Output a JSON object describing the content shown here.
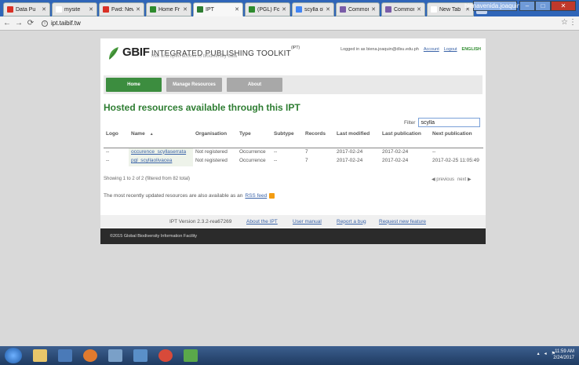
{
  "browser": {
    "tabs": [
      {
        "title": "Data Pu",
        "color": "#d93025"
      },
      {
        "title": "mysite",
        "color": "#ffffff"
      },
      {
        "title": "Fwd: New",
        "color": "#d93025"
      },
      {
        "title": "Home Fr",
        "color": "#2e8b2e"
      },
      {
        "title": "IPT",
        "color": "#2e7d32"
      },
      {
        "title": "(PGL) For",
        "color": "#2e8b2e"
      },
      {
        "title": "scylla olv",
        "color": "#4285f4"
      },
      {
        "title": "Commor",
        "color": "#7a5ca8"
      },
      {
        "title": "Commor",
        "color": "#7a5ca8"
      },
      {
        "title": "New Tab",
        "color": "#ffffff"
      }
    ],
    "profile_label": "bienavenida.joaquin...",
    "url": "ipt.taibif.tw"
  },
  "header": {
    "brand": "GBIF",
    "title": "INTEGRATED PUBLISHING TOOLKIT",
    "title_sup": "(IPT)",
    "tagline": "free and open access to biodiversity data",
    "logged_in": "Logged in as biena.joaquin@dlsu.edu.ph",
    "account": "Account",
    "logout": "Logout",
    "language": "ENGLISH"
  },
  "nav": {
    "home": "Home",
    "manage": "Manage Resources",
    "about": "About"
  },
  "heading": "Hosted resources available through this IPT",
  "filter": {
    "label": "Filter",
    "value": "scylla"
  },
  "table": {
    "headers": [
      "Logo",
      "Name",
      "Organisation",
      "Type",
      "Subtype",
      "Records",
      "Last modified",
      "Last publication",
      "Next publication"
    ],
    "rows": [
      [
        "--",
        "occurence_scyllaserrata",
        "Not registered",
        "Occurrence",
        "--",
        "7",
        "2017-02-24",
        "2017-02-24",
        "--"
      ],
      [
        "--",
        "pgl_scyllaolivacea",
        "Not registered",
        "Occurrence",
        "--",
        "7",
        "2017-02-24",
        "2017-02-24",
        "2017-02-25 11:05:49"
      ]
    ]
  },
  "showing": "Showing 1 to 2 of 2 (filtered from 82 total)",
  "pager": {
    "previous": "previous",
    "next": "next"
  },
  "rss": {
    "text": "The most recently updated resources are also available as an",
    "link": "RSS feed"
  },
  "footer": {
    "version": "IPT Version 2.3.2-rea67269",
    "about": "About the IPT",
    "manual": "User manual",
    "bug": "Report a bug",
    "feature": "Request new feature",
    "copyright": "©2015 Global Biodiversity Information Facility"
  },
  "taskbar": {
    "time": "11:59 AM",
    "date": "2/24/2017"
  }
}
